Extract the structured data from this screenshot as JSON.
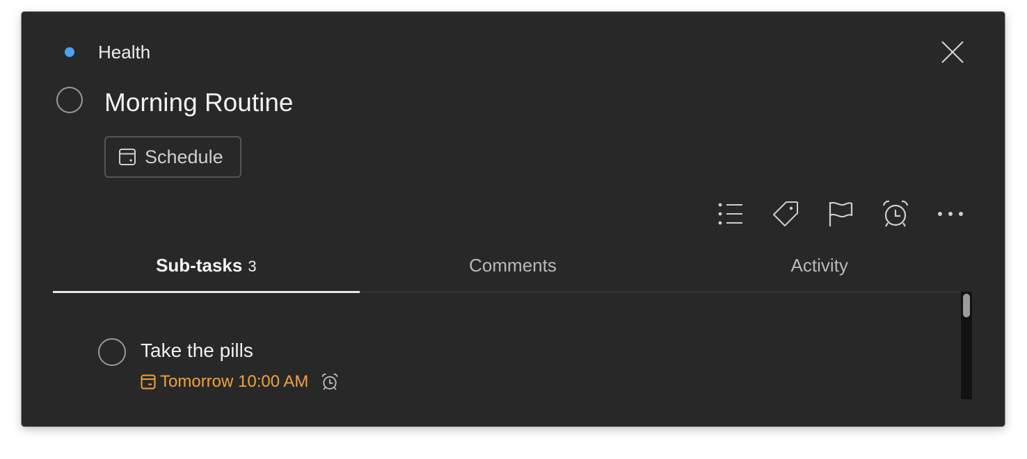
{
  "project": {
    "name": "Health",
    "color": "#4aa3f0"
  },
  "task": {
    "title": "Morning Routine",
    "schedule_label": "Schedule"
  },
  "toolbar": {
    "icons": [
      "subtasks-list-icon",
      "tag-icon",
      "flag-icon",
      "alarm-clock-icon",
      "more-horizontal-icon"
    ]
  },
  "tabs": [
    {
      "label": "Sub-tasks",
      "count": "3",
      "active": true
    },
    {
      "label": "Comments",
      "active": false
    },
    {
      "label": "Activity",
      "active": false
    }
  ],
  "subtasks": [
    {
      "title": "Take the pills",
      "due": "Tomorrow 10:00 AM",
      "due_color": "#f0a33a",
      "has_reminder": true
    }
  ],
  "colors": {
    "background": "#282828",
    "text": "#f2f2f2",
    "muted": "#b9b9b9",
    "accent_due": "#f0a33a"
  }
}
